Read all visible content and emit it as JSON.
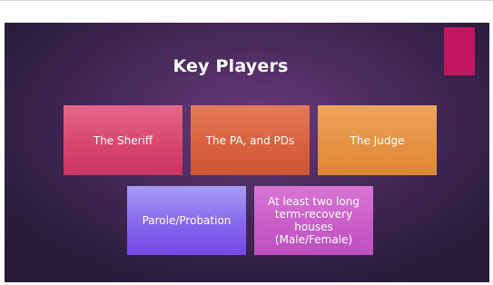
{
  "slide": {
    "title": "Key Players",
    "accent_color": "#c4155f",
    "boxes": [
      {
        "label": "The Sheriff",
        "color": "#d84770"
      },
      {
        "label": "The PA, and PDs",
        "color": "#d9623f"
      },
      {
        "label": "The Judge",
        "color": "#e59343"
      },
      {
        "label": "Parole/Probation",
        "color": "#8766ec"
      },
      {
        "label": "At least two long term-recovery houses (Male/Female)",
        "color": "#c95ec8"
      }
    ]
  }
}
